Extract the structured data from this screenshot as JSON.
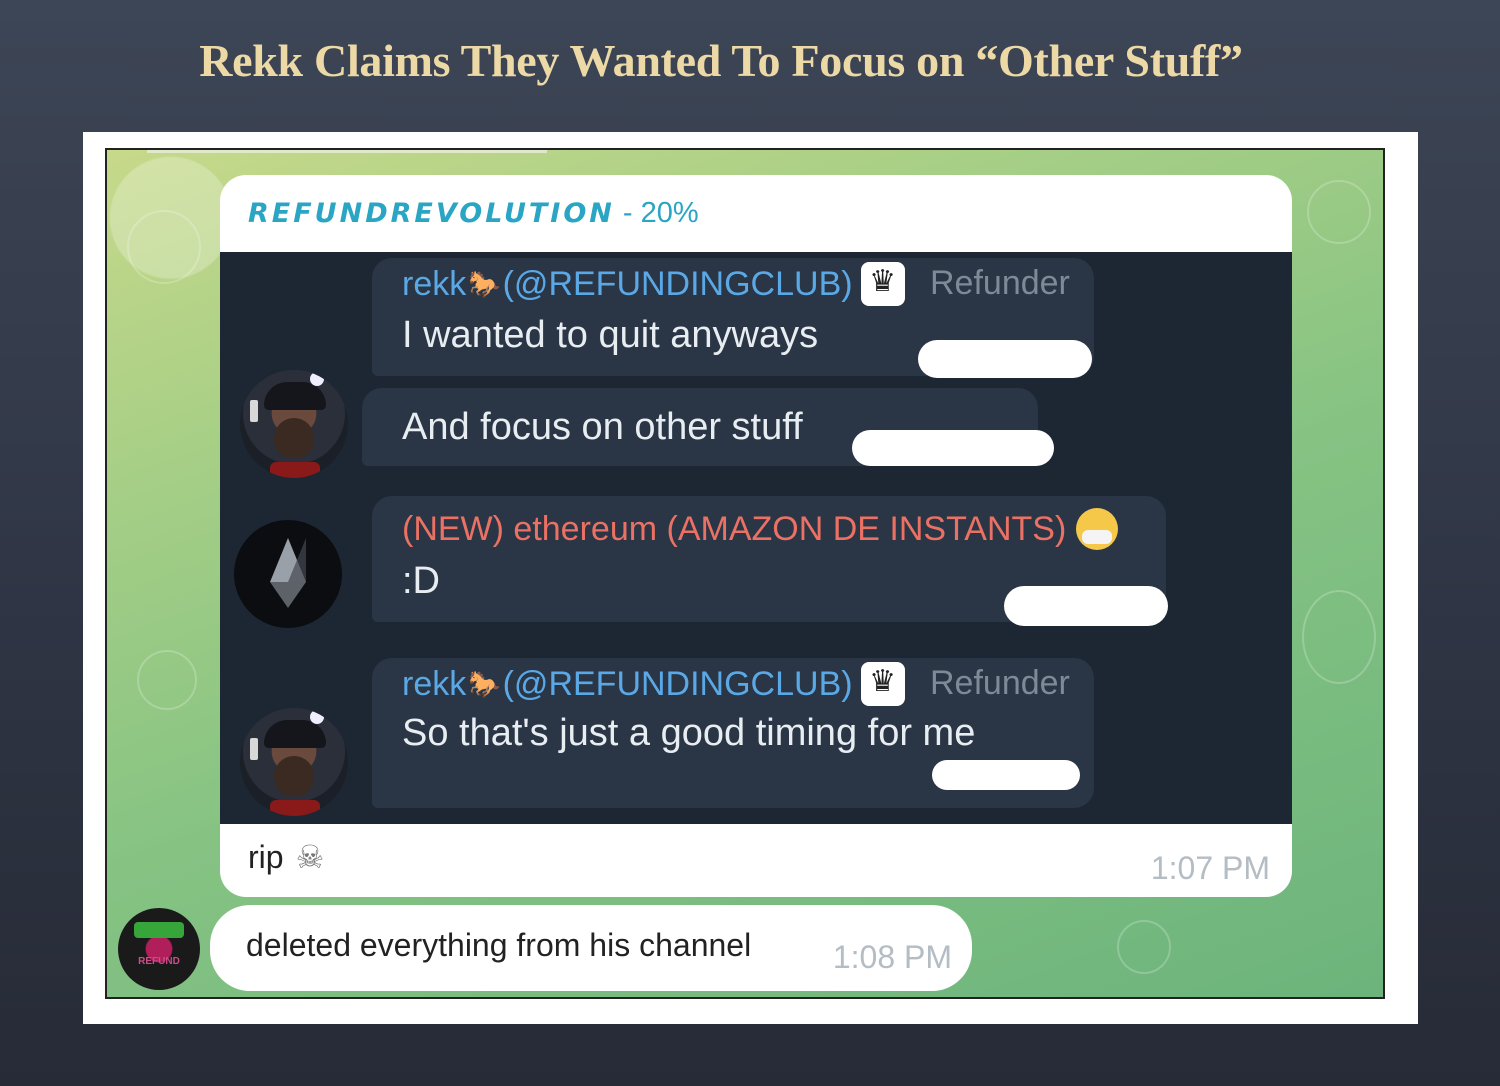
{
  "slide": {
    "title": "Rekk Claims They Wanted To Focus on “Other Stuff”"
  },
  "colors": {
    "title": "#ecd9a6",
    "brand": "#2aa5c3",
    "sender_blue": "#5aa8e6",
    "sender_red": "#ea7163"
  },
  "post": {
    "channel_name": "REFUNDREVOLUTION",
    "channel_suffix": "- 20%",
    "caption": "rip",
    "caption_icon": "skull-icon",
    "time": "1:07 PM"
  },
  "embedded_messages": [
    {
      "sender": "rekk",
      "handle": "(@REFUNDINGCLUB)",
      "rank": "Refunder",
      "text": "I wanted to quit anyways",
      "sender_icon": "horse-emoji",
      "badge_icon": "crown-badge-icon"
    },
    {
      "text": "And focus on other stuff"
    },
    {
      "sender": "(NEW) ethereum (AMAZON DE INSTANTS)",
      "text": ":D",
      "sender_icon": "mask-face-emoji"
    },
    {
      "sender": "rekk",
      "handle": "(@REFUNDINGCLUB)",
      "rank": "Refunder",
      "text": "So that's just a good timing for me",
      "sender_icon": "horse-emoji",
      "badge_icon": "crown-badge-icon"
    }
  ],
  "reply": {
    "text": "deleted everything from his channel",
    "time": "1:08 PM"
  }
}
